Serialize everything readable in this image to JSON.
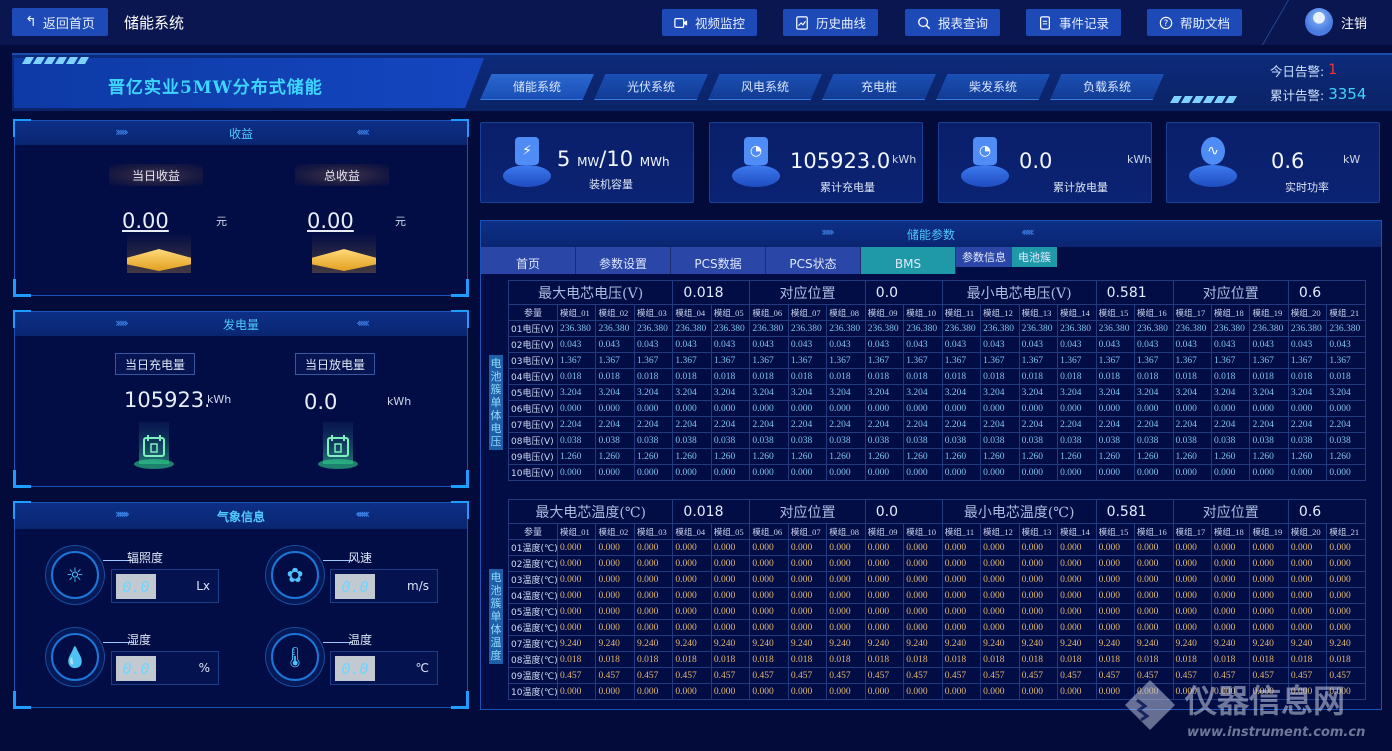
{
  "topbar": {
    "back_label": "返回首页",
    "title": "储能系统",
    "nav": [
      {
        "label": "视频监控",
        "icon": "video-icon"
      },
      {
        "label": "历史曲线",
        "icon": "chart-icon"
      },
      {
        "label": "报表查询",
        "icon": "search-icon"
      },
      {
        "label": "事件记录",
        "icon": "document-icon"
      },
      {
        "label": "帮助文档",
        "icon": "help-icon"
      }
    ],
    "logout_label": "注销"
  },
  "banner": {
    "title": "晋亿实业5MW分布式储能",
    "systems": [
      "储能系统",
      "光伏系统",
      "风电系统",
      "充电桩",
      "柴发系统",
      "负载系统"
    ],
    "active_system": "储能系统",
    "alarm_today_label": "今日告警:",
    "alarm_today_value": "1",
    "alarm_total_label": "累计告警:",
    "alarm_total_value": "3354",
    "alarm_today_color": "#ff3030",
    "alarm_total_color": "#3ed5ff"
  },
  "revenue": {
    "title": "收益",
    "daily_label": "当日收益",
    "daily_value": "0.00",
    "total_label": "总收益",
    "total_value": "0.00",
    "unit": "元"
  },
  "generation": {
    "title": "发电量",
    "charge_label": "当日充电量",
    "charge_value": "105923.0",
    "discharge_label": "当日放电量",
    "discharge_value": "0.0",
    "unit": "kWh"
  },
  "weather": {
    "title": "气象信息",
    "items": [
      {
        "label": "辐照度",
        "value": "0.0",
        "unit": "Lx",
        "icon": "sun-icon"
      },
      {
        "label": "风速",
        "value": "0.0",
        "unit": "m/s",
        "icon": "fan-icon"
      },
      {
        "label": "湿度",
        "value": "0.0",
        "unit": "%",
        "icon": "droplet-icon"
      },
      {
        "label": "温度",
        "value": "0.0",
        "unit": "℃",
        "icon": "thermometer-icon"
      }
    ]
  },
  "stats": [
    {
      "value": "5",
      "unit": "MW",
      "value2": "/10",
      "unit2": "MWh",
      "label": "装机容量",
      "icon": "battery-icon"
    },
    {
      "value": "105923.0",
      "unit": "kWh",
      "label": "累计充电量",
      "icon": "meter-icon"
    },
    {
      "value": "0.0",
      "unit": "kWh",
      "label": "累计放电量",
      "icon": "meter-icon"
    },
    {
      "value": "0.6",
      "unit": "kW",
      "label": "实时功率",
      "icon": "pulse-icon"
    }
  ],
  "params": {
    "title": "储能参数",
    "tabs": [
      "首页",
      "参数设置",
      "PCS数据",
      "PCS状态",
      "BMS"
    ],
    "active_tab": "BMS",
    "subtabs": [
      "参数信息",
      "电池簇"
    ],
    "active_subtab": "电池簇",
    "modules": [
      "模组_01",
      "模组_02",
      "模组_03",
      "模组_04",
      "模组_05",
      "模组_06",
      "模组_07",
      "模组_08",
      "模组_09",
      "模组_10",
      "模组_11",
      "模组_12",
      "模组_13",
      "模组_14",
      "模组_15",
      "模组_16",
      "模组_17",
      "模组_18",
      "模组_19",
      "模组_20",
      "模组_21"
    ],
    "param_header": "参量",
    "voltage": {
      "side_label": "电池簇单体电压",
      "max_label": "最大电芯电压(V)",
      "max_value": "0.018",
      "max_pos_label": "对应位置",
      "max_pos_value": "0.0",
      "min_label": "最小电芯电压(V)",
      "min_value": "0.581",
      "min_pos_label": "对应位置",
      "min_pos_value": "0.6",
      "rows": [
        {
          "label": "01电压(V)",
          "value": "236.380"
        },
        {
          "label": "02电压(V)",
          "value": "0.043"
        },
        {
          "label": "03电压(V)",
          "value": "1.367"
        },
        {
          "label": "04电压(V)",
          "value": "0.018"
        },
        {
          "label": "05电压(V)",
          "value": "3.204"
        },
        {
          "label": "06电压(V)",
          "value": "0.000"
        },
        {
          "label": "07电压(V)",
          "value": "2.204"
        },
        {
          "label": "08电压(V)",
          "value": "0.038"
        },
        {
          "label": "09电压(V)",
          "value": "1.260"
        },
        {
          "label": "10电压(V)",
          "value": "0.000"
        }
      ]
    },
    "temperature": {
      "side_label": "电池簇单体温度",
      "max_label": "最大电芯温度(℃)",
      "max_value": "0.018",
      "max_pos_label": "对应位置",
      "max_pos_value": "0.0",
      "min_label": "最小电芯温度(℃)",
      "min_value": "0.581",
      "min_pos_label": "对应位置",
      "min_pos_value": "0.6",
      "rows": [
        {
          "label": "01温度(℃)",
          "value": "0.000"
        },
        {
          "label": "02温度(℃)",
          "value": "0.000"
        },
        {
          "label": "03温度(℃)",
          "value": "0.000"
        },
        {
          "label": "04温度(℃)",
          "value": "0.000"
        },
        {
          "label": "05温度(℃)",
          "value": "0.000"
        },
        {
          "label": "06温度(℃)",
          "value": "0.000"
        },
        {
          "label": "07温度(℃)",
          "value": "9.240"
        },
        {
          "label": "08温度(℃)",
          "value": "0.018"
        },
        {
          "label": "09温度(℃)",
          "value": "0.457"
        },
        {
          "label": "10温度(℃)",
          "value": "0.000"
        }
      ]
    }
  },
  "watermark": {
    "title": "仪器信息网",
    "url": "www.instrument.com.cn"
  }
}
